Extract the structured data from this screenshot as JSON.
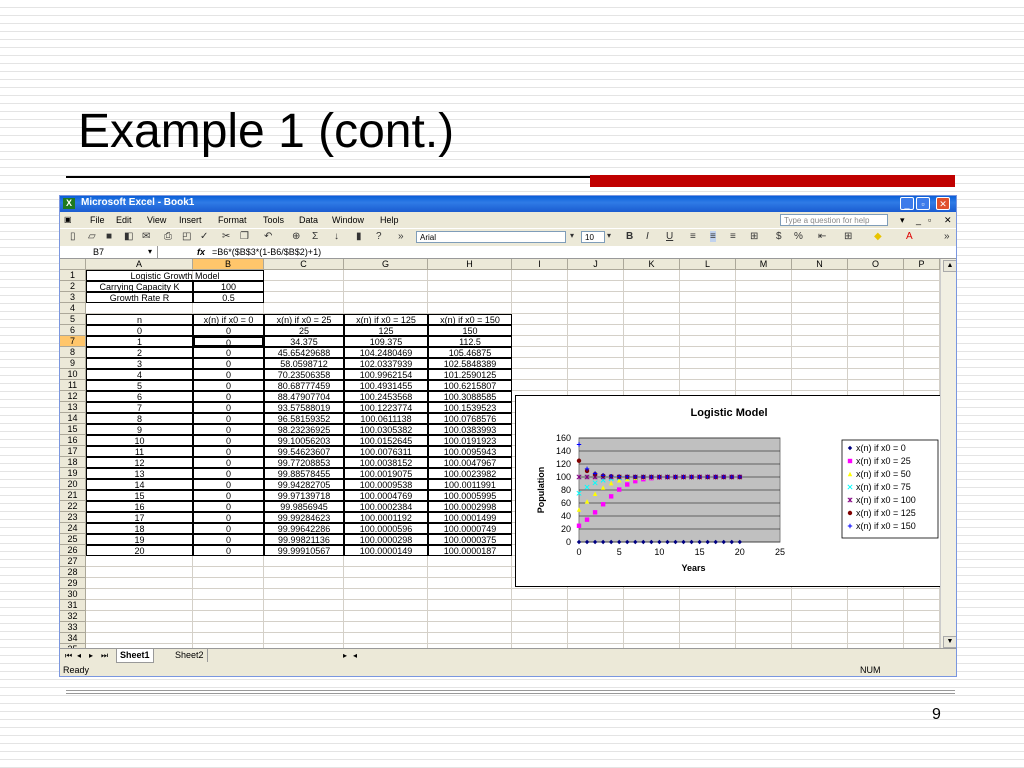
{
  "slide": {
    "title": "Example 1 (cont.)",
    "page_number": "9"
  },
  "window": {
    "title": "Microsoft Excel - Book1",
    "app_icon": "excel-icon"
  },
  "menu": [
    "File",
    "Edit",
    "View",
    "Insert",
    "Format",
    "Tools",
    "Data",
    "Window",
    "Help"
  ],
  "help_box_placeholder": "Type a question for help",
  "toolbar": {
    "font": "Arial",
    "size": "10",
    "bold": "B",
    "italic": "I",
    "underline": "U",
    "currency": "$",
    "percent": "%"
  },
  "formula_bar": {
    "cell_ref": "B7",
    "fx": "fx",
    "formula": "=B6*($B$3*(1-B6/$B$2)+1)"
  },
  "columns": [
    "A",
    "B",
    "C",
    "G",
    "H",
    "I",
    "J",
    "K",
    "L",
    "M",
    "N",
    "O",
    "P"
  ],
  "rows": [
    "1",
    "2",
    "3",
    "4",
    "5",
    "6",
    "7",
    "8",
    "9",
    "10",
    "11",
    "12",
    "13",
    "14",
    "15",
    "16",
    "17",
    "18",
    "19",
    "20",
    "21",
    "22",
    "23",
    "24",
    "25",
    "26",
    "27",
    "28",
    "29",
    "30",
    "31",
    "32",
    "33",
    "34",
    "35"
  ],
  "params": {
    "title": "Logistic Growth Model",
    "cap_label": "Carrying Capacity K",
    "cap_value": "100",
    "rate_label": "Growth Rate R",
    "rate_value": "0.5"
  },
  "table_headers": [
    "n",
    "x(n) if x0 = 0",
    "x(n) if x0 = 25",
    "x(n) if x0 = 125",
    "x(n) if x0 = 150"
  ],
  "table_rows": [
    [
      "0",
      "0",
      "25",
      "125",
      "150"
    ],
    [
      "1",
      "0",
      "34.375",
      "109.375",
      "112.5"
    ],
    [
      "2",
      "0",
      "45.65429688",
      "104.2480469",
      "105.46875"
    ],
    [
      "3",
      "0",
      "58.0598712",
      "102.0337939",
      "102.5848389"
    ],
    [
      "4",
      "0",
      "70.23506358",
      "100.9962154",
      "101.2590125"
    ],
    [
      "5",
      "0",
      "80.68777459",
      "100.4931455",
      "100.6215807"
    ],
    [
      "6",
      "0",
      "88.47907704",
      "100.2453568",
      "100.3088585"
    ],
    [
      "7",
      "0",
      "93.57588019",
      "100.1223774",
      "100.1539523"
    ],
    [
      "8",
      "0",
      "96.58159352",
      "100.0611138",
      "100.0768576"
    ],
    [
      "9",
      "0",
      "98.23236925",
      "100.0305382",
      "100.0383993"
    ],
    [
      "10",
      "0",
      "99.10056203",
      "100.0152645",
      "100.0191923"
    ],
    [
      "11",
      "0",
      "99.54623607",
      "100.0076311",
      "100.0095943"
    ],
    [
      "12",
      "0",
      "99.77208853",
      "100.0038152",
      "100.0047967"
    ],
    [
      "13",
      "0",
      "99.88578455",
      "100.0019075",
      "100.0023982"
    ],
    [
      "14",
      "0",
      "99.94282705",
      "100.0009538",
      "100.0011991"
    ],
    [
      "15",
      "0",
      "99.97139718",
      "100.0004769",
      "100.0005995"
    ],
    [
      "16",
      "0",
      "99.9856945",
      "100.0002384",
      "100.0002998"
    ],
    [
      "17",
      "0",
      "99.99284623",
      "100.0001192",
      "100.0001499"
    ],
    [
      "18",
      "0",
      "99.99642286",
      "100.0000596",
      "100.0000749"
    ],
    [
      "19",
      "0",
      "99.99821136",
      "100.0000298",
      "100.0000375"
    ],
    [
      "20",
      "0",
      "99.99910567",
      "100.0000149",
      "100.0000187"
    ]
  ],
  "sheets": [
    "Sheet1",
    "Sheet2"
  ],
  "status": {
    "left": "Ready",
    "num": "NUM"
  },
  "chart_data": {
    "type": "scatter",
    "title": "Logistic Model",
    "xlabel": "Years",
    "ylabel": "Population",
    "xlim": [
      0,
      25
    ],
    "ylim": [
      0,
      160
    ],
    "xticks": [
      "0",
      "5",
      "10",
      "15",
      "20",
      "25"
    ],
    "yticks": [
      "0",
      "20",
      "40",
      "60",
      "80",
      "100",
      "120",
      "140",
      "160"
    ],
    "legend_position": "right",
    "grid": true,
    "series": [
      {
        "name": "x(n) if x0 = 0",
        "color": "#000080",
        "marker": "diamond",
        "values": [
          0,
          0,
          0,
          0,
          0,
          0,
          0,
          0,
          0,
          0,
          0,
          0,
          0,
          0,
          0,
          0,
          0,
          0,
          0,
          0,
          0
        ]
      },
      {
        "name": "x(n) if x0 = 25",
        "color": "#ff00ff",
        "marker": "square",
        "values": [
          25,
          34.375,
          45.654,
          58.06,
          70.235,
          80.688,
          88.479,
          93.576,
          96.582,
          98.232,
          99.101,
          99.546,
          99.772,
          99.886,
          99.943,
          99.971,
          99.986,
          99.993,
          99.996,
          99.998,
          99.999
        ]
      },
      {
        "name": "x(n) if x0 = 50",
        "color": "#ffff00",
        "marker": "triangle",
        "values": [
          50,
          62.5,
          74.219,
          83.786,
          90.578,
          94.845,
          97.289,
          98.608,
          99.294,
          99.645,
          99.822,
          99.911,
          99.956,
          99.978,
          99.989,
          99.994,
          99.997,
          99.999,
          99.999,
          100,
          100
        ]
      },
      {
        "name": "x(n) if x0 = 75",
        "color": "#00ffff",
        "marker": "x",
        "values": [
          75,
          84.375,
          90.967,
          95.075,
          97.416,
          98.674,
          99.328,
          99.662,
          99.831,
          99.915,
          99.958,
          99.979,
          99.989,
          99.995,
          99.997,
          99.999,
          99.999,
          100,
          100,
          100,
          100
        ]
      },
      {
        "name": "x(n) if x0 = 100",
        "color": "#800080",
        "marker": "star",
        "values": [
          100,
          100,
          100,
          100,
          100,
          100,
          100,
          100,
          100,
          100,
          100,
          100,
          100,
          100,
          100,
          100,
          100,
          100,
          100,
          100,
          100
        ]
      },
      {
        "name": "x(n) if x0 = 125",
        "color": "#800000",
        "marker": "circle",
        "values": [
          125,
          109.375,
          104.248,
          102.034,
          100.996,
          100.493,
          100.245,
          100.122,
          100.061,
          100.031,
          100.015,
          100.008,
          100.004,
          100.002,
          100.001,
          100,
          100,
          100,
          100,
          100,
          100
        ]
      },
      {
        "name": "x(n) if x0 = 150",
        "color": "#0000ff",
        "marker": "plus",
        "values": [
          150,
          112.5,
          105.469,
          102.585,
          101.259,
          100.622,
          100.309,
          100.154,
          100.077,
          100.038,
          100.019,
          100.01,
          100.005,
          100.002,
          100.001,
          100.001,
          100,
          100,
          100,
          100,
          100
        ]
      }
    ]
  }
}
